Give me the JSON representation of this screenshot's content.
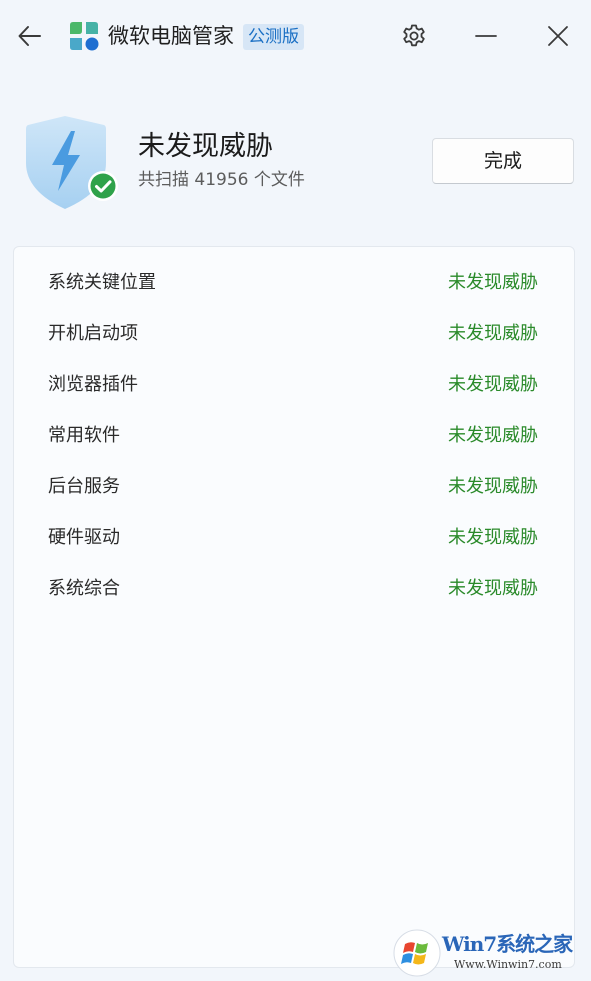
{
  "titlebar": {
    "app_name": "微软电脑管家",
    "badge": "公测版"
  },
  "header": {
    "title": "未发现威胁",
    "subtitle": "共扫描 41956 个文件",
    "done_label": "完成"
  },
  "results": [
    {
      "label": "系统关键位置",
      "status": "未发现威胁"
    },
    {
      "label": "开机启动项",
      "status": "未发现威胁"
    },
    {
      "label": "浏览器插件",
      "status": "未发现威胁"
    },
    {
      "label": "常用软件",
      "status": "未发现威胁"
    },
    {
      "label": "后台服务",
      "status": "未发现威胁"
    },
    {
      "label": "硬件驱动",
      "status": "未发现威胁"
    },
    {
      "label": "系统综合",
      "status": "未发现威胁"
    }
  ],
  "watermark": {
    "brand": "Win7系统之家",
    "url": "Www.Winwin7.com"
  },
  "colors": {
    "accent": "#1a6fc4",
    "status_ok": "#2a8a2a",
    "background": "#f2f6fb"
  },
  "icons": [
    "back-arrow-icon",
    "app-logo-icon",
    "gear-icon",
    "minimize-icon",
    "close-icon",
    "shield-lightning-icon",
    "check-circle-icon"
  ]
}
